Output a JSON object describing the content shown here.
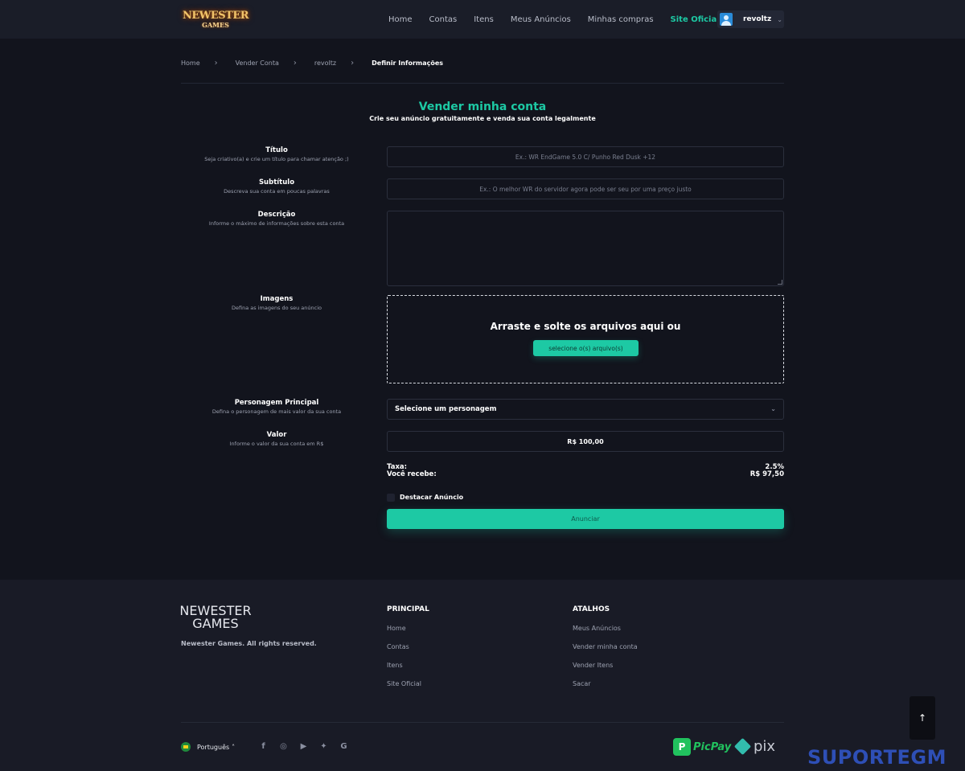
{
  "header": {
    "logo_line1": "NEWESTER",
    "logo_line2": "GAMES",
    "nav": [
      "Home",
      "Contas",
      "Itens",
      "Meus Anúncios",
      "Minhas compras",
      "Site Oficial"
    ],
    "username": "revoltz"
  },
  "breadcrumb": [
    "Home",
    "Vender Conta",
    "revoltz",
    "Definir Informações"
  ],
  "page": {
    "title": "Vender minha conta",
    "subtitle": "Crie seu anúncio gratuitamente e venda sua conta legalmente"
  },
  "form": {
    "titulo": {
      "label": "Título",
      "desc": "Seja criativo(a) e crie um título para chamar atenção ;)",
      "placeholder": "Ex.: WR EndGame 5.0 C/ Punho Red Dusk +12"
    },
    "subtitulo": {
      "label": "Subtítulo",
      "desc": "Descreva sua conta em poucas palavras",
      "placeholder": "Ex.: O melhor WR do servidor agora pode ser seu por uma preço justo"
    },
    "descricao": {
      "label": "Descrição",
      "desc": "Informe o máximo de informações sobre esta conta"
    },
    "imagens": {
      "label": "Imagens",
      "desc": "Defina as imagens do seu anúncio",
      "drop_text": "Arraste e solte os arquivos aqui ou",
      "button": "selecione o(s) arquivo(s)"
    },
    "personagem": {
      "label": "Personagem Principal",
      "desc": "Defina o personagem de mais valor da sua conta",
      "value": "Selecione um personagem"
    },
    "valor": {
      "label": "Valor",
      "desc": "Informe o valor da sua conta em R$",
      "value": "R$ 100,00"
    },
    "taxa_label": "Taxa:",
    "taxa_value": "2.5%",
    "recebe_label": "Você recebe:",
    "recebe_value": "R$ 97,50",
    "destacar": "Destacar Anúncio",
    "submit": "Anunciar"
  },
  "footer": {
    "copyright": "Newester Games. All rights reserved.",
    "principal": {
      "title": "PRINCIPAL",
      "links": [
        "Home",
        "Contas",
        "Itens",
        "Site Oficial"
      ]
    },
    "atalhos": {
      "title": "ATALHOS",
      "links": [
        "Meus Anúncios",
        "Vender minha conta",
        "Vender Itens",
        "Sacar"
      ]
    },
    "language": "Português",
    "picpay": "PicPay",
    "pix": "pix"
  },
  "watermark": "SUPORTEGM",
  "colors": {
    "accent": "#1dc9a4",
    "background": "#12141d",
    "header": "#1a1d28"
  }
}
